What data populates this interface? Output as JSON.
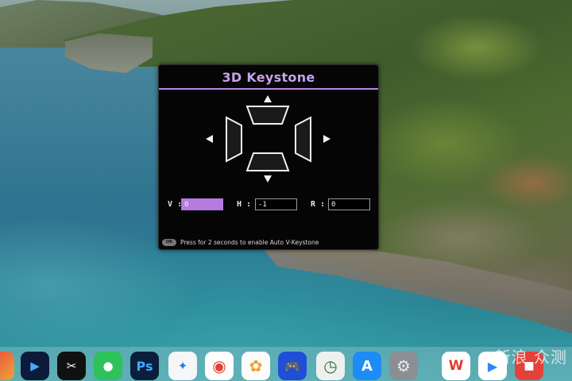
{
  "osd": {
    "title": "3D Keystone",
    "fields": [
      {
        "label": "V :",
        "value": "0",
        "active": true
      },
      {
        "label": "H :",
        "value": "-1",
        "active": false
      },
      {
        "label": "R :",
        "value": "0",
        "active": false
      }
    ],
    "ok_label": "OK",
    "hint": "Press for 2 seconds to enable Auto V-Keystone",
    "accent_color": "#b57be0"
  },
  "dock": {
    "apps": [
      {
        "name": "app-icon-partial",
        "glyph": ""
      },
      {
        "name": "infuse-icon",
        "glyph": "▶"
      },
      {
        "name": "capcut-icon",
        "glyph": "✂"
      },
      {
        "name": "wechat-icon",
        "glyph": "●"
      },
      {
        "name": "photoshop-icon",
        "glyph": "Ps"
      },
      {
        "name": "safari-icon",
        "glyph": "✦"
      },
      {
        "name": "chrome-icon",
        "glyph": "◉"
      },
      {
        "name": "photos-icon",
        "glyph": "✿"
      },
      {
        "name": "game-controller-icon",
        "glyph": "🎮"
      },
      {
        "name": "clock-icon",
        "glyph": "◷"
      },
      {
        "name": "app-store-icon",
        "glyph": "A"
      },
      {
        "name": "system-settings-icon",
        "glyph": "⚙"
      },
      {
        "name": "wps-icon",
        "glyph": "W"
      },
      {
        "name": "youku-icon",
        "glyph": "▶"
      },
      {
        "name": "news-icon",
        "glyph": "■"
      }
    ],
    "watermark": "新浪 众测"
  }
}
